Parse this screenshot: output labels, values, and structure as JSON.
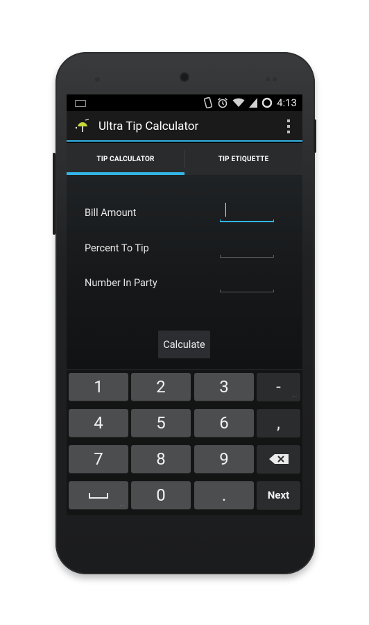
{
  "status_bar": {
    "time": "4:13",
    "icons": [
      "keyboard-icon",
      "vibrate-icon",
      "alarm-icon",
      "wifi-icon",
      "signal-icon",
      "sync-icon"
    ]
  },
  "action_bar": {
    "app_title": "Ultra Tip Calculator",
    "logo_icon": "app-logo-icon",
    "menu_icon": "overflow-menu-icon"
  },
  "tabs": [
    {
      "label": "TIP CALCULATOR",
      "active": true
    },
    {
      "label": "TIP ETIQUETTE",
      "active": false
    }
  ],
  "form": {
    "bill_amount_label": "Bill Amount",
    "bill_amount_value": "",
    "percent_label": "Percent To Tip",
    "percent_value": "",
    "party_label": "Number In Party",
    "party_value": ""
  },
  "calculate_label": "Calculate",
  "keyboard": {
    "rows": [
      [
        "1",
        "2",
        "3",
        "-"
      ],
      [
        "4",
        "5",
        "6",
        ","
      ],
      [
        "7",
        "8",
        "9",
        "⌫"
      ],
      [
        "␣",
        "0",
        ".",
        "Next"
      ]
    ]
  },
  "colors": {
    "accent": "#33b5e5",
    "screen_bg": "#151719",
    "key_bg": "#4c4d4f",
    "key_dark": "#2b2c2e"
  }
}
